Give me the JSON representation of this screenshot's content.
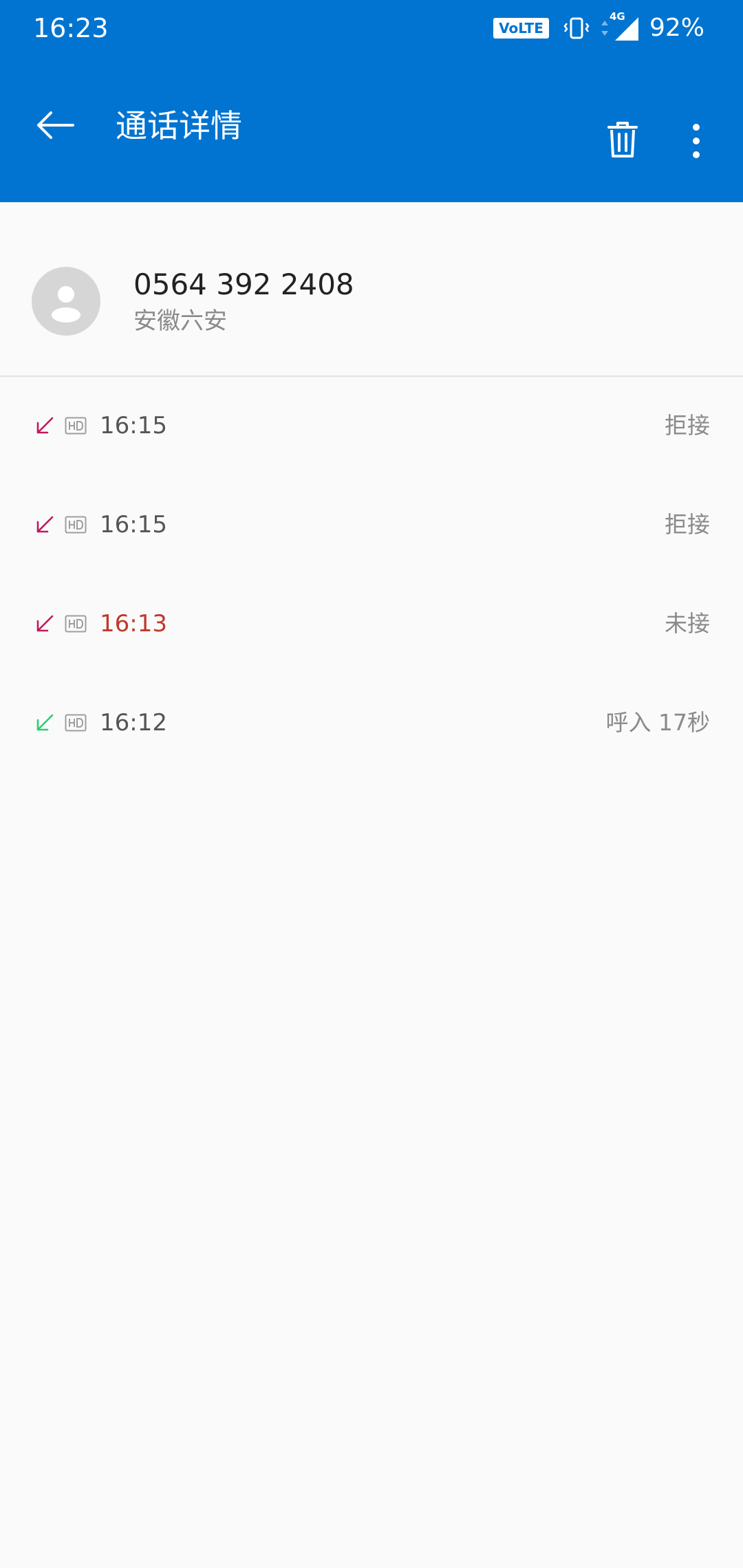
{
  "status_bar": {
    "time": "16:23",
    "volte_label": "VoLTE",
    "network_label": "4G",
    "battery": "92%"
  },
  "app_bar": {
    "title": "通话详情",
    "icons": {
      "back": "arrow-left-icon",
      "delete": "trash-icon",
      "more": "more-vertical-icon"
    }
  },
  "contact": {
    "number": "0564 392 2408",
    "location": "安徽六安"
  },
  "calls": [
    {
      "time": "16:15",
      "status": "拒接",
      "direction": "incoming-rejected"
    },
    {
      "time": "16:15",
      "status": "拒接",
      "direction": "incoming-rejected"
    },
    {
      "time": "16:13",
      "status": "未接",
      "direction": "incoming-missed"
    },
    {
      "time": "16:12",
      "status": "呼入 17秒",
      "direction": "incoming-answered"
    }
  ],
  "colors": {
    "primary": "#0074d0",
    "rejected": "#c2185b",
    "missed_time": "#c0392b",
    "answered": "#2ecc71",
    "hd_icon": "#9e9e9e"
  }
}
